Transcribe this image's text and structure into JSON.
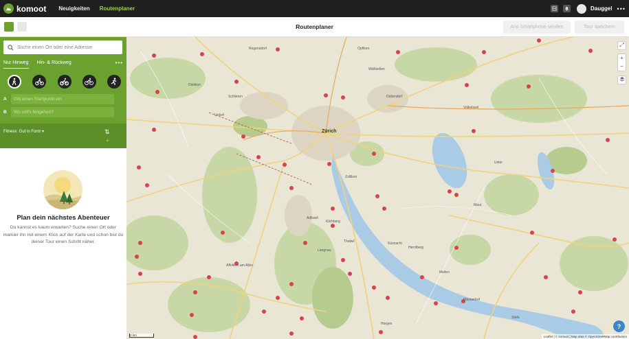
{
  "topbar": {
    "brand": "komoot",
    "nav": [
      "Neuigkeiten",
      "Routenplaner"
    ],
    "username": "Dauggel"
  },
  "subbar": {
    "title": "Routenplaner",
    "send_label": "Ans Smartphone senden",
    "save_label": "Tour speichern"
  },
  "planner": {
    "search_placeholder": "Suche einen Ort oder eine Adresse",
    "tabs": [
      "Nur Hinweg",
      "Hin- & Rückweg"
    ],
    "start_letter": "A",
    "start_placeholder": "Gib einen Startpunkt ein",
    "dest_letter": "B",
    "dest_placeholder": "Wo soll's hingehen?",
    "fitness": "Fitness: Gut in Form ▾",
    "sports": [
      "hiking-icon",
      "bike-icon",
      "mountain-bike-icon",
      "road-bike-icon",
      "running-icon"
    ]
  },
  "empty_state": {
    "title": "Plan dein nächstes Abenteuer",
    "text": "Du kannst es kaum erwarten? Suche einen Ort oder markier ihn mit einem Klick auf der Karte und schon bist du deiner Tour einen Schritt näher."
  },
  "map": {
    "labels": [
      "Zürich",
      "Schlieren",
      "Wallisellen",
      "Dübendorf",
      "Zollikon",
      "Kilchberg",
      "Adliswil",
      "Thalwil",
      "Horgen",
      "Küsnacht",
      "Herrliberg",
      "Meilen",
      "Männedorf",
      "Stäfa",
      "Affoltern am Albis",
      "Uster",
      "Urdorf",
      "Dietikon",
      "Regensdorf",
      "Opfikon",
      "Langnau",
      "Maur",
      "Volketswil"
    ],
    "attribution": "Leaflet | © komoot | Map data © OpenStreetMap contributors",
    "scale": "2 km"
  },
  "colors": {
    "brand_green": "#6aa12f",
    "topbar": "#1f1f1f",
    "lake": "#a9cbe6"
  }
}
